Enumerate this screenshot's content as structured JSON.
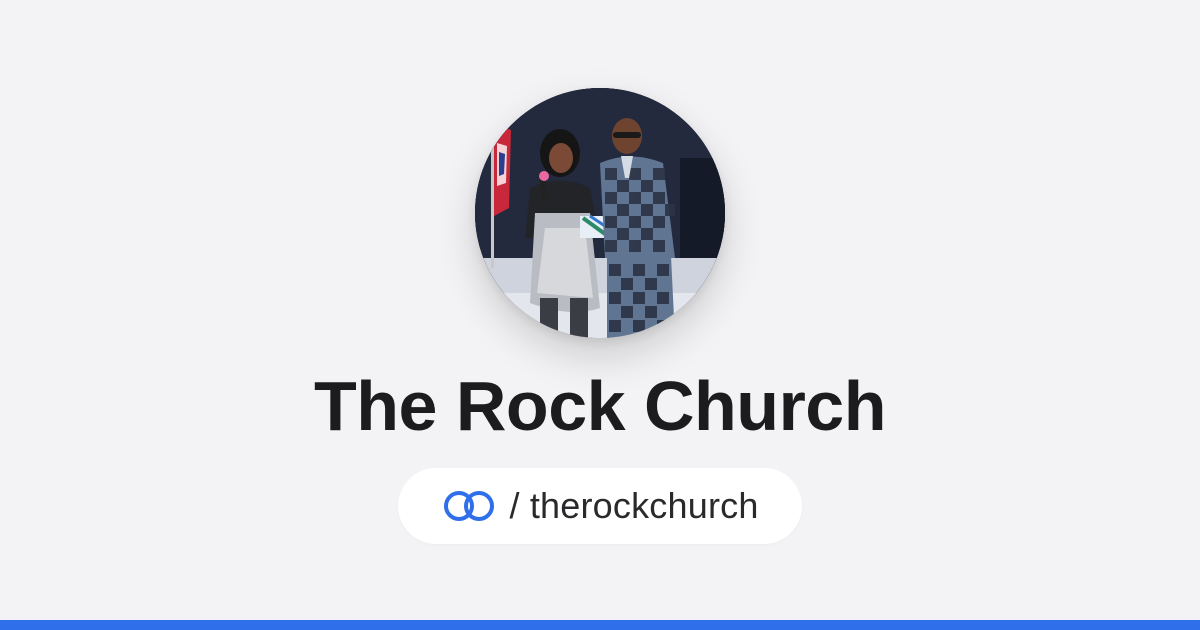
{
  "profile": {
    "name": "The Rock Church",
    "handle": "/ therockchurch",
    "avatar_alt": "profile photo",
    "logo_icon": "linked-rings-icon"
  },
  "colors": {
    "background": "#f3f3f5",
    "accent": "#2f6fe9",
    "title": "#1c1c1e"
  }
}
